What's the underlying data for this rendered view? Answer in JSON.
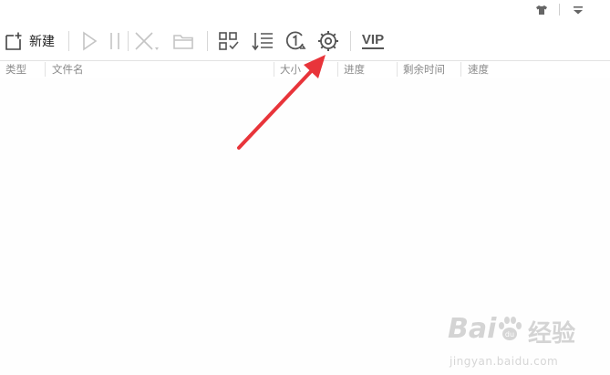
{
  "titlebar": {
    "skin_icon": "tshirt-icon",
    "menu_icon": "menu-dropdown-icon"
  },
  "toolbar": {
    "new_label": "新建",
    "new_icon": "new-task-icon",
    "start_icon": "play-icon",
    "pause_icon": "pause-icon",
    "delete_icon": "delete-icon",
    "folder_icon": "folder-icon",
    "select_icon": "select-all-icon",
    "sort_icon": "sort-icon",
    "limit_icon": "limit-one-icon",
    "settings_icon": "settings-gear-icon",
    "vip_label": "VIP"
  },
  "columns": {
    "type": "类型",
    "filename": "文件名",
    "size": "大小",
    "progress": "进度",
    "remaining": "剩余时间",
    "speed": "速度"
  },
  "watermark": {
    "brand_text": "Bai",
    "brand_text2": "经验",
    "url": "jingyan.baidu.com"
  },
  "colors": {
    "annotation_arrow": "#e8343a",
    "icon_active": "#555555",
    "icon_disabled": "#c4c4c4",
    "header_text": "#8a8a8a"
  }
}
